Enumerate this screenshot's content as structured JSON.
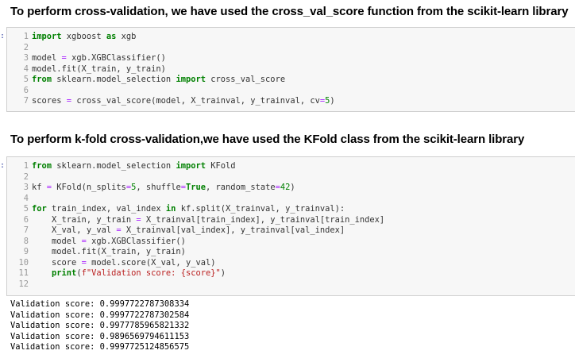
{
  "headings": {
    "cv": "To perform cross-validation, we have used the cross_val_score function from the scikit-learn library",
    "kfold": "To perform k-fold cross-validation,we have used the KFold class from the scikit-learn library"
  },
  "prompt_char": ":",
  "cell1": {
    "line_numbers": [
      "1",
      "2",
      "3",
      "4",
      "5",
      "6",
      "7"
    ],
    "lines": [
      [
        {
          "t": "import",
          "c": "kw"
        },
        {
          "t": " xgboost ",
          "c": ""
        },
        {
          "t": "as",
          "c": "kw"
        },
        {
          "t": " xgb",
          "c": ""
        }
      ],
      [],
      [
        {
          "t": "model ",
          "c": ""
        },
        {
          "t": "=",
          "c": "op"
        },
        {
          "t": " xgb.XGBClassifier()",
          "c": ""
        }
      ],
      [
        {
          "t": "model.fit(X_train, y_train)",
          "c": ""
        }
      ],
      [
        {
          "t": "from",
          "c": "kw"
        },
        {
          "t": " sklearn.model_selection ",
          "c": ""
        },
        {
          "t": "import",
          "c": "kw"
        },
        {
          "t": " cross_val_score",
          "c": ""
        }
      ],
      [],
      [
        {
          "t": "scores ",
          "c": ""
        },
        {
          "t": "=",
          "c": "op"
        },
        {
          "t": " cross_val_score(model, X_trainval, y_trainval, cv",
          "c": ""
        },
        {
          "t": "=",
          "c": "op"
        },
        {
          "t": "5",
          "c": "num"
        },
        {
          "t": ")",
          "c": ""
        }
      ]
    ]
  },
  "cell2": {
    "line_numbers": [
      "1",
      "2",
      "3",
      "4",
      "5",
      "6",
      "7",
      "8",
      "9",
      "10",
      "11",
      "12"
    ],
    "lines": [
      [
        {
          "t": "from",
          "c": "kw"
        },
        {
          "t": " sklearn.model_selection ",
          "c": ""
        },
        {
          "t": "import",
          "c": "kw"
        },
        {
          "t": " KFold",
          "c": ""
        }
      ],
      [],
      [
        {
          "t": "kf ",
          "c": ""
        },
        {
          "t": "=",
          "c": "op"
        },
        {
          "t": " KFold(n_splits",
          "c": ""
        },
        {
          "t": "=",
          "c": "op"
        },
        {
          "t": "5",
          "c": "num"
        },
        {
          "t": ", shuffle",
          "c": ""
        },
        {
          "t": "=",
          "c": "op"
        },
        {
          "t": "True",
          "c": "kw"
        },
        {
          "t": ", random_state",
          "c": ""
        },
        {
          "t": "=",
          "c": "op"
        },
        {
          "t": "42",
          "c": "num"
        },
        {
          "t": ")",
          "c": ""
        }
      ],
      [],
      [
        {
          "t": "for",
          "c": "kw"
        },
        {
          "t": " train_index, val_index ",
          "c": ""
        },
        {
          "t": "in",
          "c": "kw"
        },
        {
          "t": " kf.split(X_trainval, y_trainval):",
          "c": ""
        }
      ],
      [
        {
          "t": "    X_train, y_train ",
          "c": ""
        },
        {
          "t": "=",
          "c": "op"
        },
        {
          "t": " X_trainval[train_index], y_trainval[train_index]",
          "c": ""
        }
      ],
      [
        {
          "t": "    X_val, y_val ",
          "c": ""
        },
        {
          "t": "=",
          "c": "op"
        },
        {
          "t": " X_trainval[val_index], y_trainval[val_index]",
          "c": ""
        }
      ],
      [
        {
          "t": "    model ",
          "c": ""
        },
        {
          "t": "=",
          "c": "op"
        },
        {
          "t": " xgb.XGBClassifier()",
          "c": ""
        }
      ],
      [
        {
          "t": "    model.fit(X_train, y_train)",
          "c": ""
        }
      ],
      [
        {
          "t": "    score ",
          "c": ""
        },
        {
          "t": "=",
          "c": "op"
        },
        {
          "t": " model.score(X_val, y_val)",
          "c": ""
        }
      ],
      [
        {
          "t": "    ",
          "c": ""
        },
        {
          "t": "print",
          "c": "kw"
        },
        {
          "t": "(",
          "c": ""
        },
        {
          "t": "f\"Validation score: {score}\"",
          "c": "str"
        },
        {
          "t": ")",
          "c": ""
        }
      ],
      []
    ]
  },
  "output_lines": [
    "Validation score: 0.9997722787308334",
    "Validation score: 0.9997722787302584",
    "Validation score: 0.9977785965821332",
    "Validation score: 0.9896569794611153",
    "Validation score: 0.9997725124856575"
  ]
}
